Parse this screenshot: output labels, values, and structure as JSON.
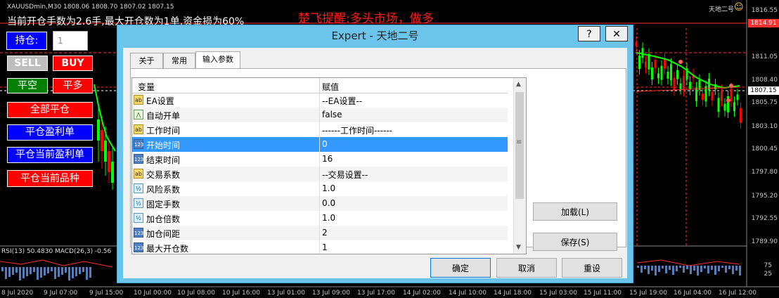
{
  "chart": {
    "symbol_header": "XAUUSDmin,M30  1808.06 1808.70 1807.02 1807.15",
    "top_info": "当前开仓手数为2.6手,最大开仓数为1单,资金损为60%",
    "alert_text": "楚飞提醒:多头市场，做多",
    "ea_name": "天地二号",
    "smiley": "☺",
    "price_axis": [
      "1816.55",
      "1814.91",
      "1811.05",
      "1808.40",
      "1807.15",
      "1805.75",
      "1803.10",
      "1800.45",
      "1797.80",
      "1795.20",
      "1792.55",
      "1789.90"
    ],
    "ask_price": "1814.91",
    "bid_price": "1807.15",
    "indicator_label": "RSI(13) 50.4830  MACD(26,3) -0.56",
    "indicator_axis": [
      "75",
      "25"
    ],
    "time_axis": [
      "8 Jul 2020",
      "9 Jul 07:00",
      "9 Jul 15:00",
      "10 Jul 00:00",
      "10 Jul 08:00",
      "10 Jul 16:00",
      "13 Jul 01:00",
      "13 Jul 09:00",
      "13 Jul 17:00",
      "14 Jul 02:00",
      "14 Jul 10:00",
      "14 Jul 18:00",
      "15 Jul 03:00",
      "15 Jul 11:00",
      "15 Jul 19:00",
      "16 Jul 04:00",
      "16 Jul 12:00"
    ],
    "colors": {
      "up": "#00ff00",
      "down": "#ff0000",
      "ma": "#00ff00",
      "macd": "#4f7fc0"
    }
  },
  "panel": {
    "position_label": "持仓:",
    "position_value": "1",
    "sell": "SELL",
    "buy": "BUY",
    "close_short": "平空",
    "close_long": "平多",
    "close_all": "全部平仓",
    "close_profit": "平仓盈利单",
    "close_current_profit": "平仓当前盈利单",
    "close_current_symbol": "平仓当前品种"
  },
  "dialog": {
    "title": "Expert - 天地二号",
    "help_btn": "?",
    "close_btn": "✕",
    "tabs": [
      "关于",
      "常用",
      "输入参数"
    ],
    "active_tab": 2,
    "header": {
      "variable": "变量",
      "value": "赋值"
    },
    "rows": [
      {
        "icon": "ab",
        "name": "EA设置",
        "value": "--EA设置--"
      },
      {
        "icon": "bool",
        "name": "自动开单",
        "value": "false"
      },
      {
        "icon": "ab",
        "name": "工作时间",
        "value": "------工作时间------"
      },
      {
        "icon": "123",
        "name": "开始时间",
        "value": "0",
        "selected": true
      },
      {
        "icon": "123",
        "name": "结束时间",
        "value": "16"
      },
      {
        "icon": "ab",
        "name": "交易系数",
        "value": "--交易设置--"
      },
      {
        "icon": "v2",
        "name": "风险系数",
        "value": "1.0"
      },
      {
        "icon": "v2",
        "name": "固定手数",
        "value": "0.0"
      },
      {
        "icon": "v2",
        "name": "加仓倍数",
        "value": "1.0"
      },
      {
        "icon": "123",
        "name": "加仓间距",
        "value": "2"
      },
      {
        "icon": "123",
        "name": "最大开仓数",
        "value": "1"
      }
    ],
    "load_btn": "加载(L)",
    "save_btn": "保存(S)",
    "ok_btn": "确定",
    "cancel_btn": "取消",
    "reset_btn": "重设"
  }
}
